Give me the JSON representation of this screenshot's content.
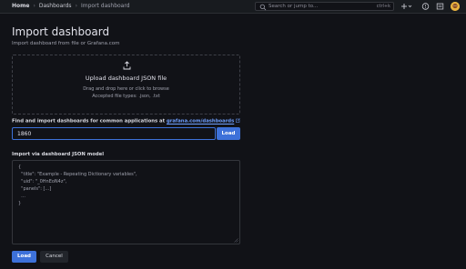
{
  "breadcrumb": {
    "home": "Home",
    "section": "Dashboards",
    "current": "Import dashboard"
  },
  "search": {
    "placeholder": "Search or jump to...",
    "shortcut": "ctrl+k"
  },
  "toolbar": {
    "add_icon": "plus-icon",
    "help_icon": "help-icon",
    "news_icon": "news-icon",
    "avatar": "user-avatar"
  },
  "page": {
    "title": "Import dashboard",
    "subtitle": "Import dashboard from file or Grafana.com"
  },
  "upload": {
    "icon": "upload-icon",
    "title": "Upload dashboard JSON file",
    "hint": "Drag and drop here or click to browse",
    "accepted": "Accepted file types: .json, .txt"
  },
  "grafana_com": {
    "label": "Find and import dashboards for common applications at ",
    "link": "grafana.com/dashboards",
    "value": "1860",
    "load_label": "Load"
  },
  "json_model": {
    "label": "Import via dashboard JSON model",
    "lines": [
      "{",
      "  \"title\": \"Example - Repeating Dictionary variables\",",
      "  \"uid\": \"_0HnEoN4z\",",
      "  \"panels\": [...]",
      "  ...",
      "}"
    ]
  },
  "actions": {
    "load": "Load",
    "cancel": "Cancel"
  },
  "colors": {
    "background": "#111217",
    "primary": "#3d71d9",
    "link": "#6e9fff",
    "avatar": "#e8b23f"
  }
}
